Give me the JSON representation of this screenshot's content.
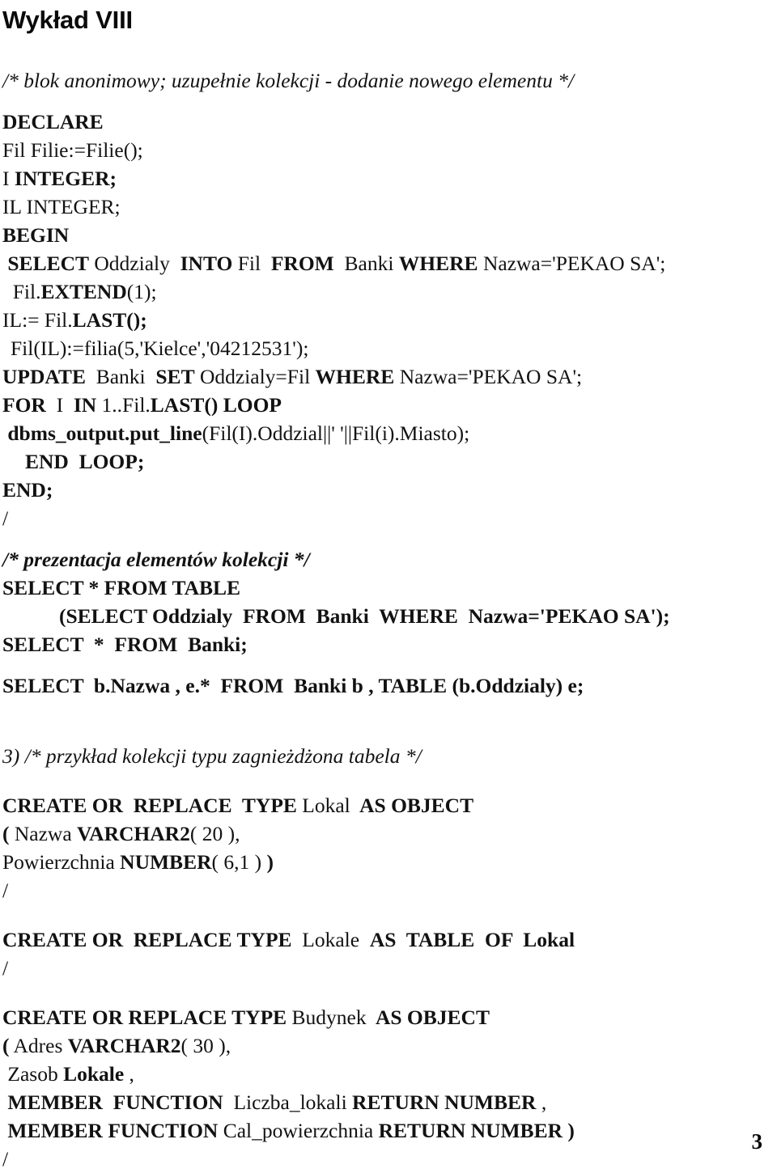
{
  "document": {
    "title": "Wykład VIII",
    "page_number": "3",
    "language": "pl"
  },
  "colors": {
    "page_background": "#ffffff",
    "text": "#0a0a0a"
  },
  "code_listing": {
    "lines": [
      {
        "id": "comment-anon-block",
        "text": "/* blok anonimowy; uzupełnie kolekcji - dodanie nowego elementu */",
        "style": "italic"
      },
      {
        "id": "declare",
        "text": "DECLARE",
        "style": "bold"
      },
      {
        "id": "decl-fil",
        "text": "Fil Filie:=Filie();",
        "style": "regular"
      },
      {
        "id": "decl-i",
        "text": "I INTEGER;",
        "style": "mixed",
        "parts": [
          {
            "text": "I ",
            "style": "regular"
          },
          {
            "text": "INTEGER;",
            "style": "bold"
          }
        ]
      },
      {
        "id": "decl-il",
        "text": "IL INTEGER;",
        "style": "regular"
      },
      {
        "id": "begin",
        "text": "BEGIN",
        "style": "bold"
      },
      {
        "id": "select-into",
        "text": "SELECT Oddzialy  INTO Fil  FROM  Banki WHERE Nazwa='PEKAO SA';",
        "style": "mixed",
        "parts": [
          {
            "text": " SELECT",
            "style": "bold"
          },
          {
            "text": " Oddzialy ",
            "style": "regular"
          },
          {
            "text": " INTO",
            "style": "bold"
          },
          {
            "text": " Fil ",
            "style": "regular"
          },
          {
            "text": " FROM",
            "style": "bold"
          },
          {
            "text": "  Banki ",
            "style": "regular"
          },
          {
            "text": "WHERE",
            "style": "bold"
          },
          {
            "text": " Nazwa='PEKAO SA';",
            "style": "regular"
          }
        ]
      },
      {
        "id": "fil-extend",
        "text": "Fil.EXTEND(1);",
        "style": "mixed",
        "parts": [
          {
            "text": "  Fil.",
            "style": "regular"
          },
          {
            "text": "EXTEND",
            "style": "bold"
          },
          {
            "text": "(1);",
            "style": "regular"
          }
        ]
      },
      {
        "id": "il-assign-last",
        "text": "IL:= Fil.LAST();",
        "style": "mixed",
        "parts": [
          {
            "text": "IL:= Fil.",
            "style": "regular"
          },
          {
            "text": "LAST();",
            "style": "bold"
          }
        ]
      },
      {
        "id": "fil-assign-filia",
        "text": "Fil(IL):=filia(5,'Kielce','04212531');",
        "style": "regular"
      },
      {
        "id": "update-banki",
        "text": "UPDATE  Banki  SET Oddzialy=Fil WHERE Nazwa='PEKAO SA';",
        "style": "mixed",
        "parts": [
          {
            "text": "UPDATE",
            "style": "bold"
          },
          {
            "text": "  Banki  ",
            "style": "regular"
          },
          {
            "text": "SET",
            "style": "bold"
          },
          {
            "text": " Oddzialy=Fil ",
            "style": "regular"
          },
          {
            "text": "WHERE",
            "style": "bold"
          },
          {
            "text": " Nazwa='PEKAO SA';",
            "style": "regular"
          }
        ]
      },
      {
        "id": "for-loop",
        "text": "FOR  I  IN 1..Fil.LAST() LOOP",
        "style": "mixed",
        "parts": [
          {
            "text": "FOR",
            "style": "bold"
          },
          {
            "text": "  I  ",
            "style": "regular"
          },
          {
            "text": "IN",
            "style": "bold"
          },
          {
            "text": " 1..Fil.",
            "style": "regular"
          },
          {
            "text": "LAST() LOOP",
            "style": "bold"
          }
        ]
      },
      {
        "id": "dbms-output",
        "text": "dbms_output.put_line(Fil(I).Oddzial||' '||Fil(i).Miasto);",
        "style": "mixed",
        "parts": [
          {
            "text": " dbms_output.put_line",
            "style": "bold"
          },
          {
            "text": "(Fil(I).Oddzial||' '||Fil(i).Miasto);",
            "style": "regular"
          }
        ]
      },
      {
        "id": "end-loop",
        "text": "END  LOOP;",
        "style": "bold",
        "indent": 1
      },
      {
        "id": "end",
        "text": "END;",
        "style": "bold"
      },
      {
        "id": "slash-1",
        "text": "/",
        "style": "regular"
      },
      {
        "id": "comment-prezentacja",
        "text": "/* prezentacja elementów kolekcji */",
        "style": "bold-italic"
      },
      {
        "id": "select-from-table",
        "text": "SELECT * FROM TABLE",
        "style": "bold"
      },
      {
        "id": "subselect-oddzialy",
        "text": "(SELECT Oddzialy  FROM  Banki  WHERE  Nazwa='PEKAO SA');",
        "style": "bold",
        "indent": 2
      },
      {
        "id": "select-from-banki",
        "text": "SELECT  *  FROM  Banki;",
        "style": "bold"
      },
      {
        "id": "select-bnazwa",
        "text": "SELECT  b.Nazwa , e.*  FROM  Banki b , TABLE (b.Oddzialy) e;",
        "style": "bold"
      },
      {
        "id": "comment-zagniezdzona",
        "text": "3) /* przykład kolekcji typu zagnieżdżona tabela */",
        "style": "italic"
      },
      {
        "id": "create-type-lokal",
        "text": "CREATE OR  REPLACE  TYPE Lokal  AS OBJECT",
        "style": "mixed",
        "parts": [
          {
            "text": "CREATE OR  REPLACE  TYPE",
            "style": "bold"
          },
          {
            "text": " Lokal ",
            "style": "regular"
          },
          {
            "text": " AS OBJECT",
            "style": "bold"
          }
        ]
      },
      {
        "id": "lokal-nazwa",
        "text": "( Nazwa VARCHAR2( 20 ),",
        "style": "mixed",
        "parts": [
          {
            "text": "(",
            "style": "bold"
          },
          {
            "text": " Nazwa ",
            "style": "regular"
          },
          {
            "text": "VARCHAR2",
            "style": "bold"
          },
          {
            "text": "( 20 ),",
            "style": "regular"
          }
        ]
      },
      {
        "id": "lokal-powierzchnia",
        "text": "Powierzchnia NUMBER( 6,1 ) )",
        "style": "mixed",
        "parts": [
          {
            "text": "Powierzchnia ",
            "style": "regular"
          },
          {
            "text": "NUMBER",
            "style": "bold"
          },
          {
            "text": "( 6,1 ) ",
            "style": "regular"
          },
          {
            "text": ")",
            "style": "bold"
          }
        ]
      },
      {
        "id": "slash-2",
        "text": "/",
        "style": "regular"
      },
      {
        "id": "create-type-lokale",
        "text": "CREATE OR  REPLACE TYPE  Lokale  AS  TABLE  OF  Lokal",
        "style": "mixed",
        "parts": [
          {
            "text": "CREATE OR  REPLACE TYPE",
            "style": "bold"
          },
          {
            "text": "  Lokale  ",
            "style": "regular"
          },
          {
            "text": "AS  TABLE  OF  Lokal",
            "style": "bold"
          }
        ]
      },
      {
        "id": "slash-3",
        "text": "/",
        "style": "regular"
      },
      {
        "id": "create-type-budynek",
        "text": "CREATE OR REPLACE TYPE Budynek  AS OBJECT",
        "style": "mixed",
        "parts": [
          {
            "text": "CREATE OR REPLACE TYPE",
            "style": "bold"
          },
          {
            "text": " Budynek ",
            "style": "regular"
          },
          {
            "text": " AS OBJECT",
            "style": "bold"
          }
        ]
      },
      {
        "id": "budynek-adres",
        "text": "( Adres VARCHAR2( 30 ),",
        "style": "mixed",
        "parts": [
          {
            "text": "(",
            "style": "bold"
          },
          {
            "text": " Adres ",
            "style": "regular"
          },
          {
            "text": "VARCHAR2",
            "style": "bold"
          },
          {
            "text": "( 30 ),",
            "style": "regular"
          }
        ]
      },
      {
        "id": "budynek-zasob",
        "text": "Zasob Lokale ,",
        "style": "mixed",
        "parts": [
          {
            "text": " Zasob ",
            "style": "regular"
          },
          {
            "text": "Lokale",
            "style": "bold"
          },
          {
            "text": " ,",
            "style": "regular"
          }
        ]
      },
      {
        "id": "budynek-member-liczba",
        "text": "MEMBER  FUNCTION  Liczba_lokali RETURN NUMBER ,",
        "style": "mixed",
        "parts": [
          {
            "text": " MEMBER  FUNCTION",
            "style": "bold"
          },
          {
            "text": "  Liczba_lokali ",
            "style": "regular"
          },
          {
            "text": "RETURN NUMBER",
            "style": "bold"
          },
          {
            "text": " ,",
            "style": "regular"
          }
        ]
      },
      {
        "id": "budynek-member-cal",
        "text": "MEMBER FUNCTION Cal_powierzchnia RETURN NUMBER )",
        "style": "mixed",
        "parts": [
          {
            "text": " MEMBER FUNCTION",
            "style": "bold"
          },
          {
            "text": " Cal_powierzchnia ",
            "style": "regular"
          },
          {
            "text": "RETURN NUMBER )",
            "style": "bold"
          }
        ]
      },
      {
        "id": "slash-4",
        "text": "/",
        "style": "regular"
      }
    ]
  }
}
